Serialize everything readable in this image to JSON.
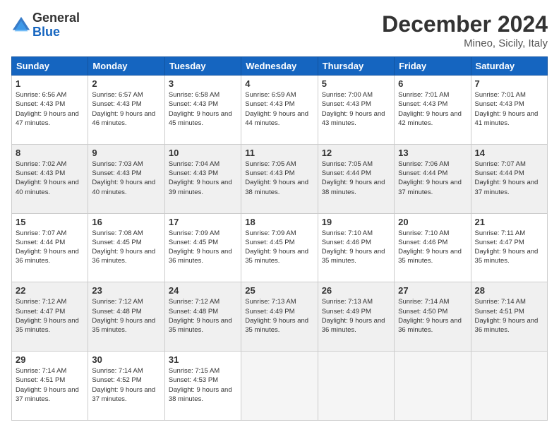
{
  "logo": {
    "general": "General",
    "blue": "Blue"
  },
  "title": "December 2024",
  "subtitle": "Mineo, Sicily, Italy",
  "headers": [
    "Sunday",
    "Monday",
    "Tuesday",
    "Wednesday",
    "Thursday",
    "Friday",
    "Saturday"
  ],
  "weeks": [
    [
      {
        "day": "1",
        "sunrise": "6:56 AM",
        "sunset": "4:43 PM",
        "daylight": "9 hours and 47 minutes."
      },
      {
        "day": "2",
        "sunrise": "6:57 AM",
        "sunset": "4:43 PM",
        "daylight": "9 hours and 46 minutes."
      },
      {
        "day": "3",
        "sunrise": "6:58 AM",
        "sunset": "4:43 PM",
        "daylight": "9 hours and 45 minutes."
      },
      {
        "day": "4",
        "sunrise": "6:59 AM",
        "sunset": "4:43 PM",
        "daylight": "9 hours and 44 minutes."
      },
      {
        "day": "5",
        "sunrise": "7:00 AM",
        "sunset": "4:43 PM",
        "daylight": "9 hours and 43 minutes."
      },
      {
        "day": "6",
        "sunrise": "7:01 AM",
        "sunset": "4:43 PM",
        "daylight": "9 hours and 42 minutes."
      },
      {
        "day": "7",
        "sunrise": "7:01 AM",
        "sunset": "4:43 PM",
        "daylight": "9 hours and 41 minutes."
      }
    ],
    [
      {
        "day": "8",
        "sunrise": "7:02 AM",
        "sunset": "4:43 PM",
        "daylight": "9 hours and 40 minutes."
      },
      {
        "day": "9",
        "sunrise": "7:03 AM",
        "sunset": "4:43 PM",
        "daylight": "9 hours and 40 minutes."
      },
      {
        "day": "10",
        "sunrise": "7:04 AM",
        "sunset": "4:43 PM",
        "daylight": "9 hours and 39 minutes."
      },
      {
        "day": "11",
        "sunrise": "7:05 AM",
        "sunset": "4:43 PM",
        "daylight": "9 hours and 38 minutes."
      },
      {
        "day": "12",
        "sunrise": "7:05 AM",
        "sunset": "4:44 PM",
        "daylight": "9 hours and 38 minutes."
      },
      {
        "day": "13",
        "sunrise": "7:06 AM",
        "sunset": "4:44 PM",
        "daylight": "9 hours and 37 minutes."
      },
      {
        "day": "14",
        "sunrise": "7:07 AM",
        "sunset": "4:44 PM",
        "daylight": "9 hours and 37 minutes."
      }
    ],
    [
      {
        "day": "15",
        "sunrise": "7:07 AM",
        "sunset": "4:44 PM",
        "daylight": "9 hours and 36 minutes."
      },
      {
        "day": "16",
        "sunrise": "7:08 AM",
        "sunset": "4:45 PM",
        "daylight": "9 hours and 36 minutes."
      },
      {
        "day": "17",
        "sunrise": "7:09 AM",
        "sunset": "4:45 PM",
        "daylight": "9 hours and 36 minutes."
      },
      {
        "day": "18",
        "sunrise": "7:09 AM",
        "sunset": "4:45 PM",
        "daylight": "9 hours and 35 minutes."
      },
      {
        "day": "19",
        "sunrise": "7:10 AM",
        "sunset": "4:46 PM",
        "daylight": "9 hours and 35 minutes."
      },
      {
        "day": "20",
        "sunrise": "7:10 AM",
        "sunset": "4:46 PM",
        "daylight": "9 hours and 35 minutes."
      },
      {
        "day": "21",
        "sunrise": "7:11 AM",
        "sunset": "4:47 PM",
        "daylight": "9 hours and 35 minutes."
      }
    ],
    [
      {
        "day": "22",
        "sunrise": "7:12 AM",
        "sunset": "4:47 PM",
        "daylight": "9 hours and 35 minutes."
      },
      {
        "day": "23",
        "sunrise": "7:12 AM",
        "sunset": "4:48 PM",
        "daylight": "9 hours and 35 minutes."
      },
      {
        "day": "24",
        "sunrise": "7:12 AM",
        "sunset": "4:48 PM",
        "daylight": "9 hours and 35 minutes."
      },
      {
        "day": "25",
        "sunrise": "7:13 AM",
        "sunset": "4:49 PM",
        "daylight": "9 hours and 35 minutes."
      },
      {
        "day": "26",
        "sunrise": "7:13 AM",
        "sunset": "4:49 PM",
        "daylight": "9 hours and 36 minutes."
      },
      {
        "day": "27",
        "sunrise": "7:14 AM",
        "sunset": "4:50 PM",
        "daylight": "9 hours and 36 minutes."
      },
      {
        "day": "28",
        "sunrise": "7:14 AM",
        "sunset": "4:51 PM",
        "daylight": "9 hours and 36 minutes."
      }
    ],
    [
      {
        "day": "29",
        "sunrise": "7:14 AM",
        "sunset": "4:51 PM",
        "daylight": "9 hours and 37 minutes."
      },
      {
        "day": "30",
        "sunrise": "7:14 AM",
        "sunset": "4:52 PM",
        "daylight": "9 hours and 37 minutes."
      },
      {
        "day": "31",
        "sunrise": "7:15 AM",
        "sunset": "4:53 PM",
        "daylight": "9 hours and 38 minutes."
      },
      null,
      null,
      null,
      null
    ]
  ]
}
